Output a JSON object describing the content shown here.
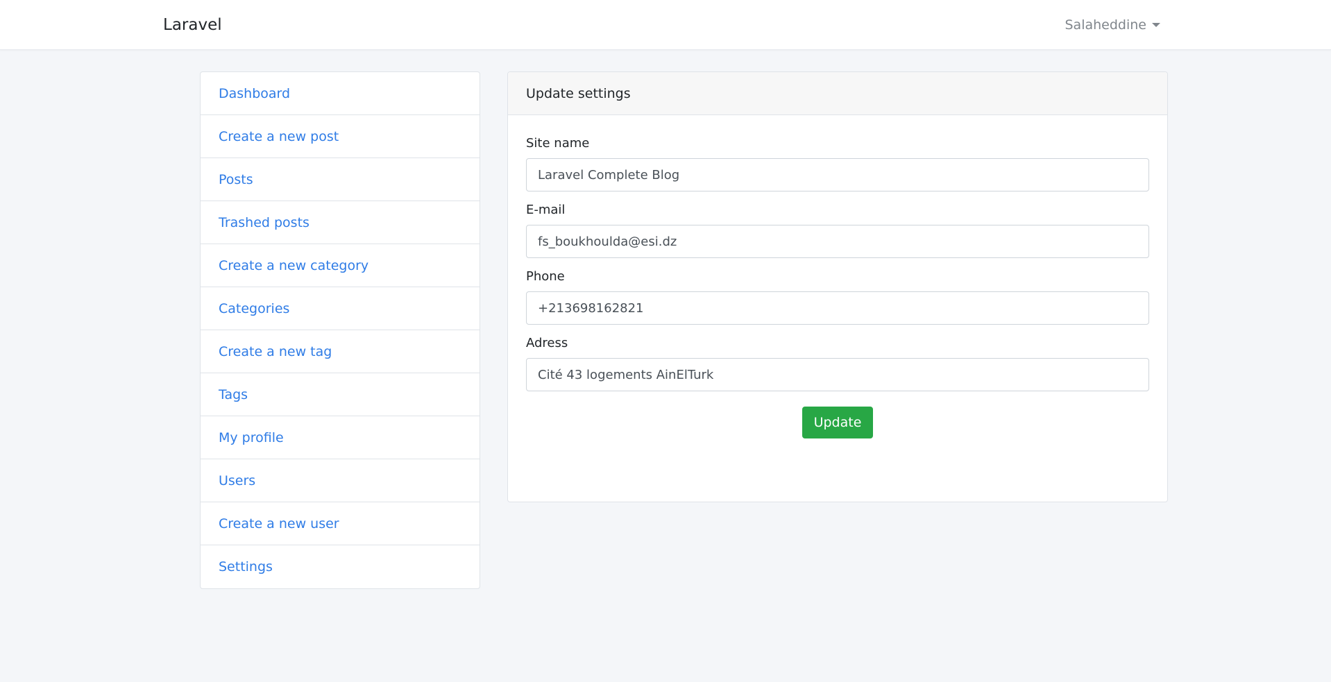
{
  "navbar": {
    "brand": "Laravel",
    "user_name": "Salaheddine"
  },
  "sidebar": {
    "items": [
      {
        "label": "Dashboard"
      },
      {
        "label": "Create a new post"
      },
      {
        "label": "Posts"
      },
      {
        "label": "Trashed posts"
      },
      {
        "label": "Create a new category"
      },
      {
        "label": "Categories"
      },
      {
        "label": "Create a new tag"
      },
      {
        "label": "Tags"
      },
      {
        "label": "My profile"
      },
      {
        "label": "Users"
      },
      {
        "label": "Create a new user"
      },
      {
        "label": "Settings"
      }
    ]
  },
  "settings_card": {
    "title": "Update settings",
    "fields": {
      "site_name": {
        "label": "Site name",
        "value": "Laravel Complete Blog"
      },
      "email": {
        "label": "E-mail",
        "value": "fs_boukhoulda@esi.dz"
      },
      "phone": {
        "label": "Phone",
        "value": "+213698162821"
      },
      "address": {
        "label": "Adress",
        "value": "Cité 43 logements AinElTurk"
      }
    },
    "submit_label": "Update"
  },
  "colors": {
    "link": "#2f7ce6",
    "success": "#28a745",
    "background": "#f4f6f9"
  }
}
